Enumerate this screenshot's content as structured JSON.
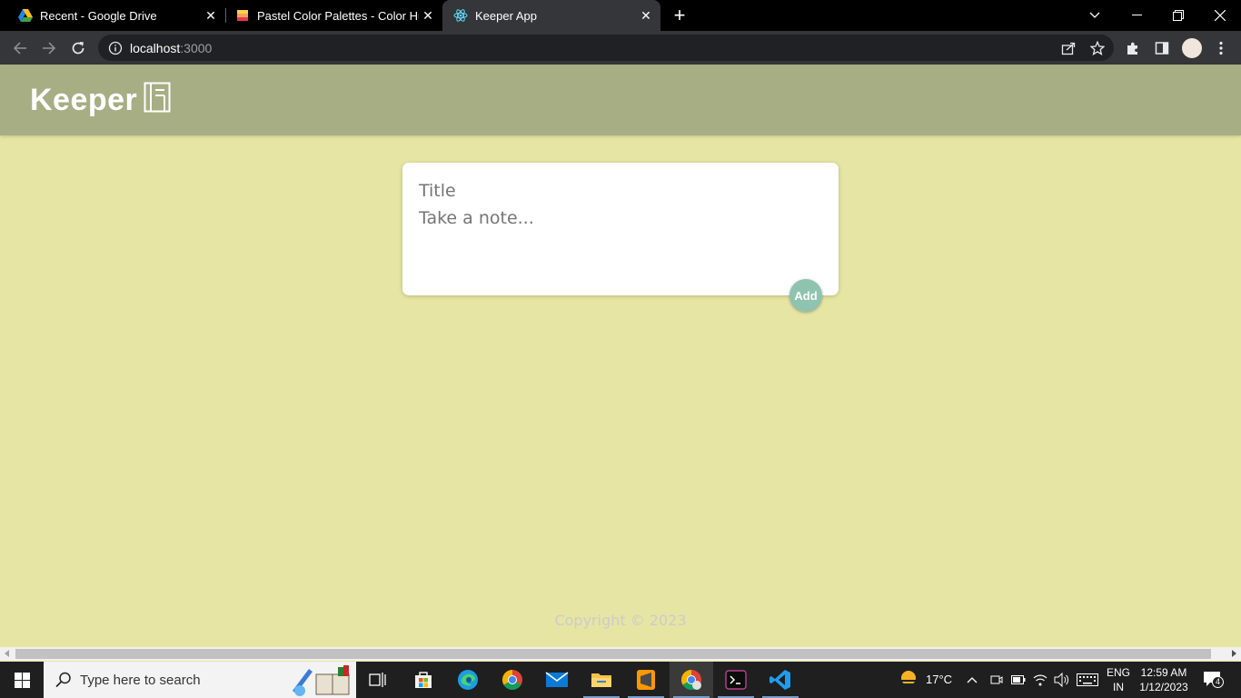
{
  "browser": {
    "tabs": [
      {
        "title": "Recent - Google Drive",
        "icon": "google-drive-icon",
        "active": false
      },
      {
        "title": "Pastel Color Palettes - Color Hunt",
        "icon": "color-hunt-icon",
        "active": false
      },
      {
        "title": "Keeper App",
        "icon": "react-icon",
        "active": true
      }
    ],
    "address": {
      "host": "localhost",
      "port": ":3000"
    }
  },
  "app": {
    "logo_text": "Keeper",
    "logo_icon": "notebook-icon",
    "form": {
      "title_placeholder": "Title",
      "title_value": "",
      "content_placeholder": "Take a note...",
      "content_value": "",
      "add_label": "Add"
    },
    "footer": "Copyright © 2023",
    "colors": {
      "background": "#e6e5a3",
      "header": "#a7ae84",
      "add_button": "#8ec3b0"
    }
  },
  "taskbar": {
    "search_placeholder": "Type here to search",
    "weather": "17°C",
    "language": "ENG",
    "region": "IN",
    "time": "12:59 AM",
    "date": "1/12/2023",
    "notifications": "4"
  }
}
